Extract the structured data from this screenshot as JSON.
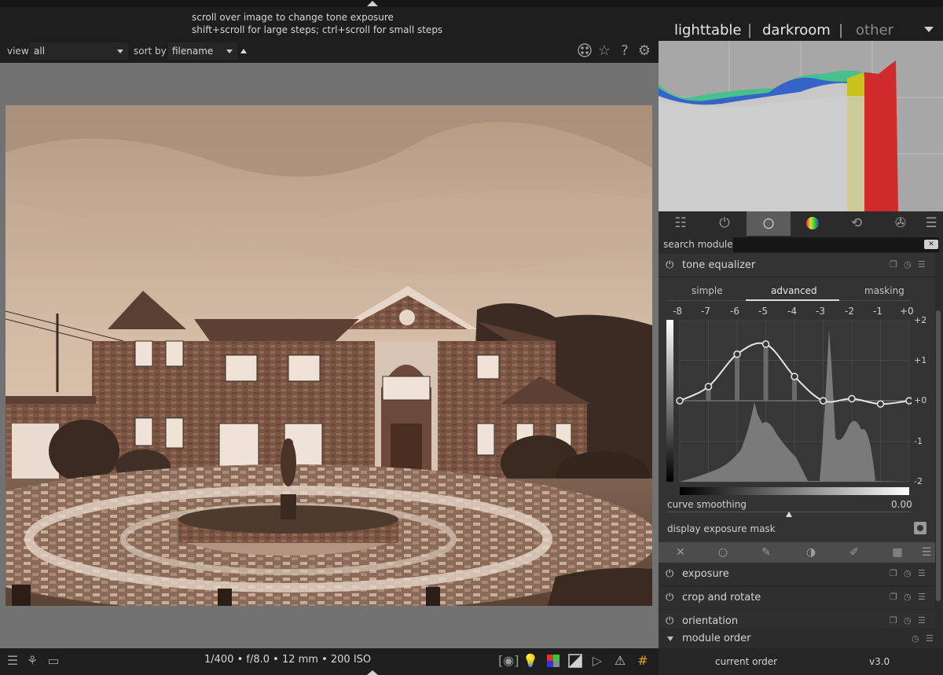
{
  "tooltip": {
    "line1": "scroll over image to change tone exposure",
    "line2": "shift+scroll for large steps; ctrl+scroll for small steps"
  },
  "filterbar": {
    "view_label": "view",
    "view_value": "all",
    "sort_label": "sort by",
    "sort_value": "filename",
    "icons": [
      "overlays-icon",
      "star-icon",
      "help-icon",
      "gear-icon"
    ]
  },
  "views": {
    "lighttable": "lighttable",
    "separator": "|",
    "darkroom": "darkroom",
    "other": "other"
  },
  "module_groups": [
    "quick-access-icon",
    "active-modules-icon",
    "base-group-icon",
    "tone-group-icon",
    "color-group-icon",
    "correct-group-icon",
    "effect-group-icon",
    "presets-menu-icon"
  ],
  "search": {
    "label": "search module",
    "value": ""
  },
  "tone_equalizer": {
    "title": "tone equalizer",
    "tabs": [
      "simple",
      "advanced",
      "masking"
    ],
    "active_tab": "advanced",
    "ev_labels": [
      "-8",
      "-7",
      "-6",
      "-5",
      "-4",
      "-3",
      "-2",
      "-1",
      "+0"
    ],
    "y_labels": [
      "+2",
      "+1",
      "+0",
      "-1",
      "-2"
    ],
    "ev_values": [
      0.0,
      0.35,
      1.15,
      1.4,
      0.6,
      0.0,
      0.05,
      -0.08,
      0.0
    ],
    "curve_smoothing_label": "curve smoothing",
    "curve_smoothing_value": "0.00",
    "curve_smoothing_fraction": 0.5,
    "display_mask_label": "display exposure mask"
  },
  "mask_tools": [
    "off-icon",
    "drawn-mask-icon",
    "drawn-mask-pen-icon",
    "parametric-mask-icon",
    "combined-mask-icon",
    "raster-mask-icon",
    "mask-menu-icon"
  ],
  "modules": [
    {
      "name": "exposure"
    },
    {
      "name": "crop and rotate"
    },
    {
      "name": "orientation"
    }
  ],
  "module_order": {
    "label": "module order",
    "current_label": "current order",
    "version": "v3.0"
  },
  "statusbar": {
    "exif": "1/400 • f/8.0 • 12 mm • 200 ISO"
  },
  "colors": {
    "histogram_bg": "#a7a7a7",
    "panel_bg": "#2c2c2c",
    "center_bg": "#727272",
    "sepia_light": "#d9c1ac",
    "sepia_dark": "#3a2a20"
  }
}
